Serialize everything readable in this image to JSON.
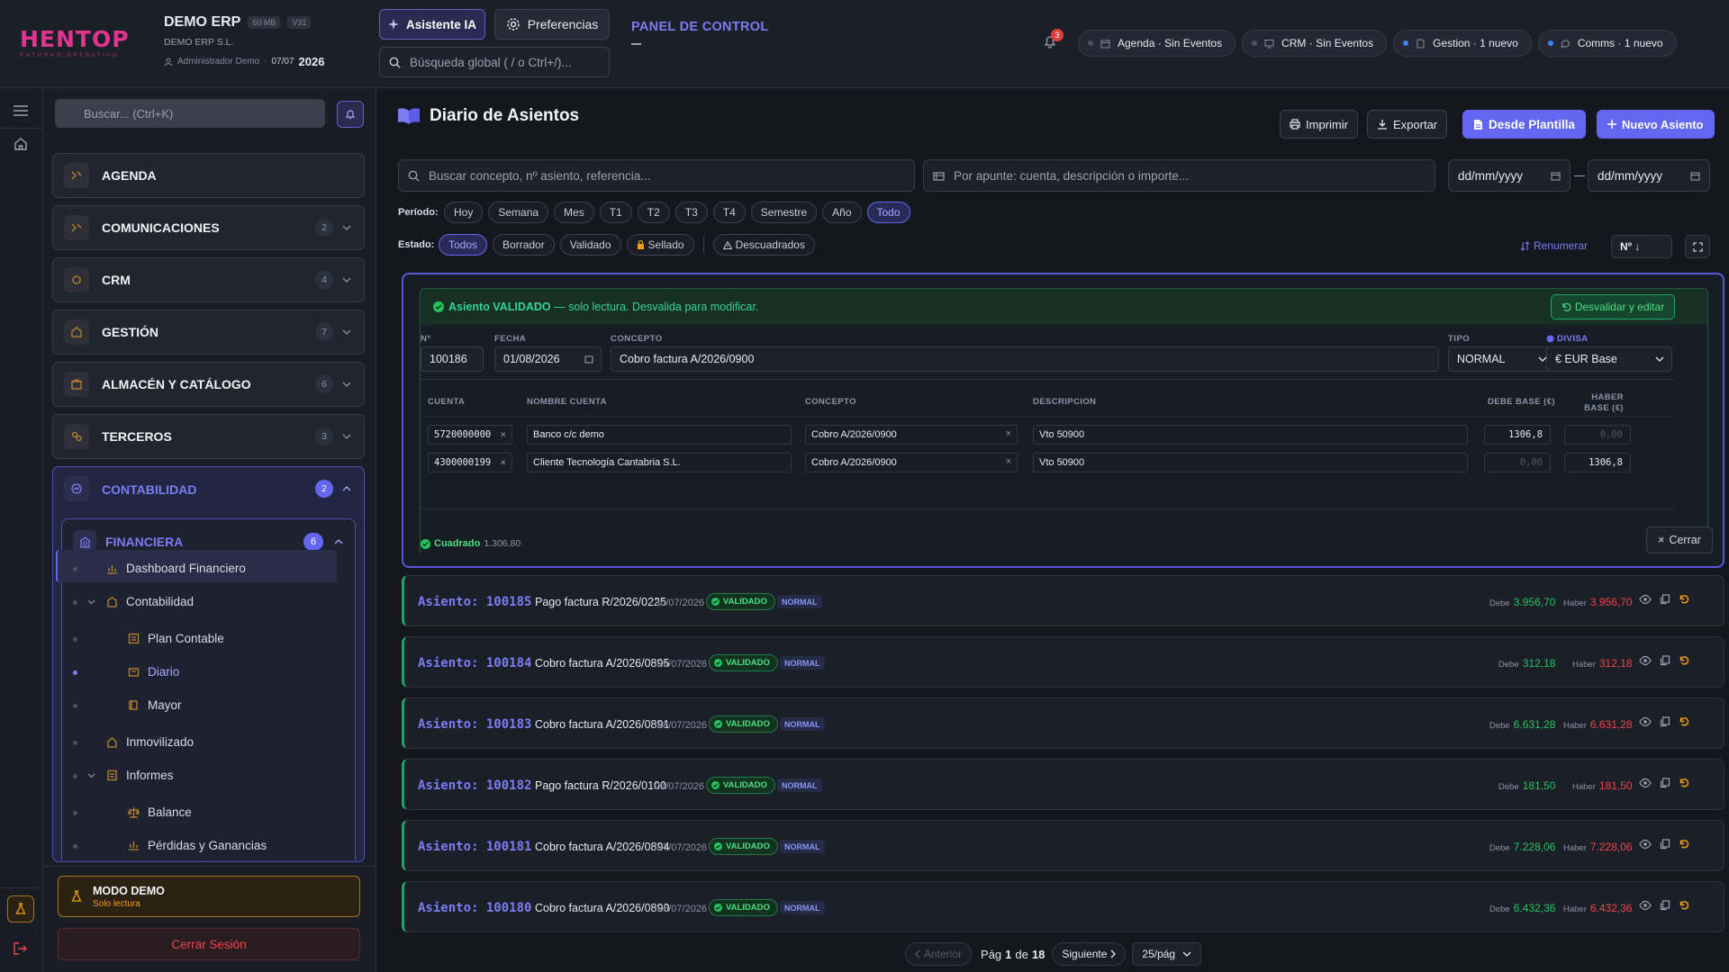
{
  "topbar": {
    "logo_text": "HENTOP",
    "logo_sub": "ENTORNO OPERATIVO",
    "company": "DEMO ERP",
    "size_badge": "60 MB",
    "version_badge": "V31",
    "company_legal": "DEMO ERP S.L.",
    "user": "Administrador Demo",
    "date": "07/07",
    "year": "2026",
    "ai_button": "Asistente IA",
    "prefs_button": "Preferencias",
    "search_placeholder": "Búsqueda global ( / o Ctrl+/)...",
    "panel_title": "PANEL DE CONTROL",
    "notif_count": "3",
    "chips": [
      {
        "label": "Agenda · Sin Eventos",
        "dot": "gray"
      },
      {
        "label": "CRM · Sin Eventos",
        "dot": "gray"
      },
      {
        "label": "Gestion · 1 nuevo",
        "dot": "blue"
      },
      {
        "label": "Comms · 1 nuevo",
        "dot": "blue"
      }
    ]
  },
  "sidebar": {
    "search_placeholder": "Buscar... (Ctrl+K)",
    "modules": [
      {
        "label": "AGENDA",
        "count": ""
      },
      {
        "label": "COMUNICACIONES",
        "count": "2"
      },
      {
        "label": "CRM",
        "count": "4"
      },
      {
        "label": "GESTIÓN",
        "count": "7"
      },
      {
        "label": "ALMACÉN Y CATÁLOGO",
        "count": "6"
      },
      {
        "label": "TERCEROS",
        "count": "3"
      },
      {
        "label": "CONTABILIDAD",
        "count": "2"
      }
    ],
    "sub_module": {
      "label": "FINANCIERA",
      "count": "6"
    },
    "tree": [
      "Dashboard Financiero",
      "Contabilidad",
      "Plan Contable",
      "Diario",
      "Mayor",
      "Inmovilizado",
      "Informes",
      "Balance",
      "Pérdidas y Ganancias"
    ],
    "demo_title": "MODO DEMO",
    "demo_sub": "Solo lectura",
    "logout": "Cerrar Sesión"
  },
  "main": {
    "title": "Diario de Asientos",
    "print": "Imprimir",
    "export": "Exportar",
    "from_template": "Desde Plantilla",
    "new_entry": "Nuevo Asiento",
    "search_placeholder": "Buscar concepto, nº asiento, referencia...",
    "apunte_placeholder": "Por apunte: cuenta, descripción o importe...",
    "date_from": "dd/mm/yyyy",
    "date_to": "dd/mm/yyyy",
    "period_label": "Período:",
    "periods": [
      "Hoy",
      "Semana",
      "Mes",
      "T1",
      "T2",
      "T3",
      "T4",
      "Semestre",
      "Año",
      "Todo"
    ],
    "period_active": "Todo",
    "state_label": "Estado:",
    "states": [
      "Todos",
      "Borrador",
      "Validado",
      "Sellado",
      "Descuadrados"
    ],
    "renumber": "Renumerar",
    "sort": "Nº ↓"
  },
  "expanded": {
    "banner_strong": "Asiento VALIDADO",
    "banner_rest": " — solo lectura. Desvalida para modificar.",
    "unvalidate_button": "Desvalidar y editar",
    "labels": {
      "n": "Nº",
      "fecha": "FECHA",
      "concepto": "CONCEPTO",
      "tipo": "TIPO",
      "divisa": "DIVISA"
    },
    "n": "100186",
    "fecha": "01/08/2026",
    "concepto": "Cobro factura A/2026/0900",
    "tipo": "NORMAL",
    "divisa": "€ EUR Base",
    "table_headers": [
      "CUENTA",
      "NOMBRE CUENTA",
      "CONCEPTO",
      "DESCRIPCION",
      "DEBE BASE (€)",
      "HABER BASE (€)"
    ],
    "lines": [
      {
        "cuenta": "5720000000",
        "nombre": "Banco c/c demo",
        "concepto": "Cobro A/2026/0900",
        "descripcion": "Vto 50900",
        "debe": "1306,8",
        "haber": "0,00"
      },
      {
        "cuenta": "4300000199",
        "nombre": "Cliente Tecnología Cantabria S.L.",
        "concepto": "Cobro A/2026/0900",
        "descripcion": "Vto 50900",
        "debe": "0,00",
        "haber": "1306,8"
      }
    ],
    "balanced_label": "Cuadrado",
    "balanced_amount": "1.306,80",
    "close": "Cerrar"
  },
  "entries": [
    {
      "id": "Asiento: 100185",
      "concepto": "Pago factura R/2026/0225",
      "fecha": "30/07/2026",
      "estado": "VALIDADO",
      "tipo": "NORMAL",
      "debe": "3.956,70",
      "haber": "3.956,70"
    },
    {
      "id": "Asiento: 100184",
      "concepto": "Cobro factura A/2026/0895",
      "fecha": "29/07/2026",
      "estado": "VALIDADO",
      "tipo": "NORMAL",
      "debe": "312,18",
      "haber": "312,18"
    },
    {
      "id": "Asiento: 100183",
      "concepto": "Cobro factura A/2026/0891",
      "fecha": "28/07/2026",
      "estado": "VALIDADO",
      "tipo": "NORMAL",
      "debe": "6.631,28",
      "haber": "6.631,28"
    },
    {
      "id": "Asiento: 100182",
      "concepto": "Pago factura R/2026/0100",
      "fecha": "27/07/2026",
      "estado": "VALIDADO",
      "tipo": "NORMAL",
      "debe": "181,50",
      "haber": "181,50"
    },
    {
      "id": "Asiento: 100181",
      "concepto": "Cobro factura A/2026/0894",
      "fecha": "27/07/2026",
      "estado": "VALIDADO",
      "tipo": "NORMAL",
      "debe": "7.228,06",
      "haber": "7.228,06"
    },
    {
      "id": "Asiento: 100180",
      "concepto": "Cobro factura A/2026/0890",
      "fecha": "26/07/2026",
      "estado": "VALIDADO",
      "tipo": "NORMAL",
      "debe": "6.432,36",
      "haber": "6.432,36"
    }
  ],
  "labels": {
    "debe": "Debe",
    "haber": "Haber"
  },
  "pagination": {
    "prev": "Anterior",
    "page_prefix": "Pág",
    "page": "1",
    "of": "de",
    "total": "18",
    "next": "Siguiente",
    "per_page": "25/pág"
  },
  "colors": {
    "accent": "#6366f1",
    "success": "#22c55e",
    "danger": "#ef4444",
    "warning": "#f59e0b",
    "brand": "#e0348f"
  }
}
